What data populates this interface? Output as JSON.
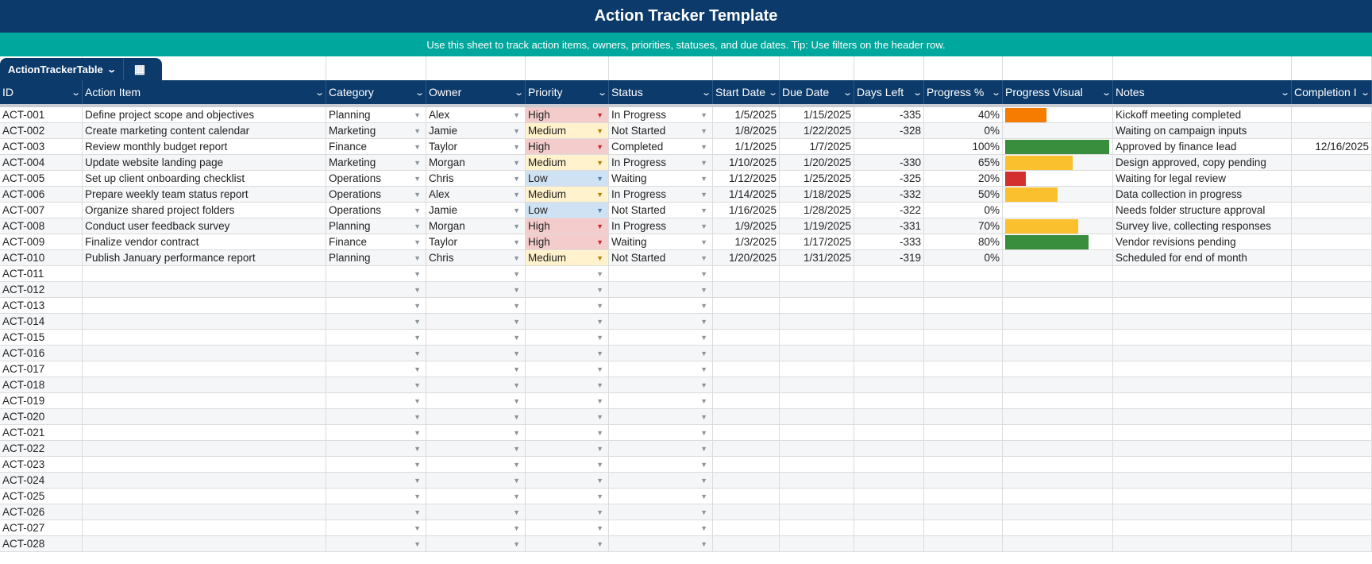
{
  "title": "Action Tracker Template",
  "subtitle": "Use this sheet to track action items, owners, priorities, statuses, and due dates. Tip: Use filters on the header row.",
  "table_name": "ActionTrackerTable",
  "columns": [
    "ID",
    "Action Item",
    "Category",
    "Owner",
    "Priority",
    "Status",
    "Start Date",
    "Due Date",
    "Days Left",
    "Progress %",
    "Progress Visual",
    "Notes",
    "Completion I"
  ],
  "colors": {
    "header": "#0b3a6b",
    "banner": "#00a79d",
    "high": "#f4cccc",
    "medium": "#fff2cc",
    "low": "#cfe2f3",
    "bar_red": "#d32f2f",
    "bar_orange": "#f57c00",
    "bar_yellow": "#fbc02d",
    "bar_green": "#388e3c"
  },
  "rows": [
    {
      "id": "ACT-001",
      "action": "Define project scope and objectives",
      "category": "Planning",
      "owner": "Alex",
      "priority": "High",
      "status": "In Progress",
      "start": "1/5/2025",
      "due": "1/15/2025",
      "days_left": "-335",
      "progress": "40%",
      "progress_value": 40,
      "notes": "Kickoff meeting completed",
      "completion": ""
    },
    {
      "id": "ACT-002",
      "action": "Create marketing content calendar",
      "category": "Marketing",
      "owner": "Jamie",
      "priority": "Medium",
      "status": "Not Started",
      "start": "1/8/2025",
      "due": "1/22/2025",
      "days_left": "-328",
      "progress": "0%",
      "progress_value": 0,
      "notes": "Waiting on campaign inputs",
      "completion": ""
    },
    {
      "id": "ACT-003",
      "action": "Review monthly budget report",
      "category": "Finance",
      "owner": "Taylor",
      "priority": "High",
      "status": "Completed",
      "start": "1/1/2025",
      "due": "1/7/2025",
      "days_left": "",
      "progress": "100%",
      "progress_value": 100,
      "notes": "Approved by finance lead",
      "completion": "12/16/2025"
    },
    {
      "id": "ACT-004",
      "action": "Update website landing page",
      "category": "Marketing",
      "owner": "Morgan",
      "priority": "Medium",
      "status": "In Progress",
      "start": "1/10/2025",
      "due": "1/20/2025",
      "days_left": "-330",
      "progress": "65%",
      "progress_value": 65,
      "notes": "Design approved, copy pending",
      "completion": ""
    },
    {
      "id": "ACT-005",
      "action": "Set up client onboarding checklist",
      "category": "Operations",
      "owner": "Chris",
      "priority": "Low",
      "status": "Waiting",
      "start": "1/12/2025",
      "due": "1/25/2025",
      "days_left": "-325",
      "progress": "20%",
      "progress_value": 20,
      "notes": "Waiting for legal review",
      "completion": ""
    },
    {
      "id": "ACT-006",
      "action": "Prepare weekly team status report",
      "category": "Operations",
      "owner": "Alex",
      "priority": "Medium",
      "status": "In Progress",
      "start": "1/14/2025",
      "due": "1/18/2025",
      "days_left": "-332",
      "progress": "50%",
      "progress_value": 50,
      "notes": "Data collection in progress",
      "completion": ""
    },
    {
      "id": "ACT-007",
      "action": "Organize shared project folders",
      "category": "Operations",
      "owner": "Jamie",
      "priority": "Low",
      "status": "Not Started",
      "start": "1/16/2025",
      "due": "1/28/2025",
      "days_left": "-322",
      "progress": "0%",
      "progress_value": 0,
      "notes": "Needs folder structure approval",
      "completion": ""
    },
    {
      "id": "ACT-008",
      "action": "Conduct user feedback survey",
      "category": "Planning",
      "owner": "Morgan",
      "priority": "High",
      "status": "In Progress",
      "start": "1/9/2025",
      "due": "1/19/2025",
      "days_left": "-331",
      "progress": "70%",
      "progress_value": 70,
      "notes": "Survey live, collecting responses",
      "completion": ""
    },
    {
      "id": "ACT-009",
      "action": "Finalize vendor contract",
      "category": "Finance",
      "owner": "Taylor",
      "priority": "High",
      "status": "Waiting",
      "start": "1/3/2025",
      "due": "1/17/2025",
      "days_left": "-333",
      "progress": "80%",
      "progress_value": 80,
      "notes": "Vendor revisions pending",
      "completion": ""
    },
    {
      "id": "ACT-010",
      "action": "Publish January performance report",
      "category": "Planning",
      "owner": "Chris",
      "priority": "Medium",
      "status": "Not Started",
      "start": "1/20/2025",
      "due": "1/31/2025",
      "days_left": "-319",
      "progress": "0%",
      "progress_value": 0,
      "notes": "Scheduled for end of month",
      "completion": ""
    },
    {
      "id": "ACT-011"
    },
    {
      "id": "ACT-012"
    },
    {
      "id": "ACT-013"
    },
    {
      "id": "ACT-014"
    },
    {
      "id": "ACT-015"
    },
    {
      "id": "ACT-016"
    },
    {
      "id": "ACT-017"
    },
    {
      "id": "ACT-018"
    },
    {
      "id": "ACT-019"
    },
    {
      "id": "ACT-020"
    },
    {
      "id": "ACT-021"
    },
    {
      "id": "ACT-022"
    },
    {
      "id": "ACT-023"
    },
    {
      "id": "ACT-024"
    },
    {
      "id": "ACT-025"
    },
    {
      "id": "ACT-026"
    },
    {
      "id": "ACT-027"
    },
    {
      "id": "ACT-028"
    }
  ]
}
